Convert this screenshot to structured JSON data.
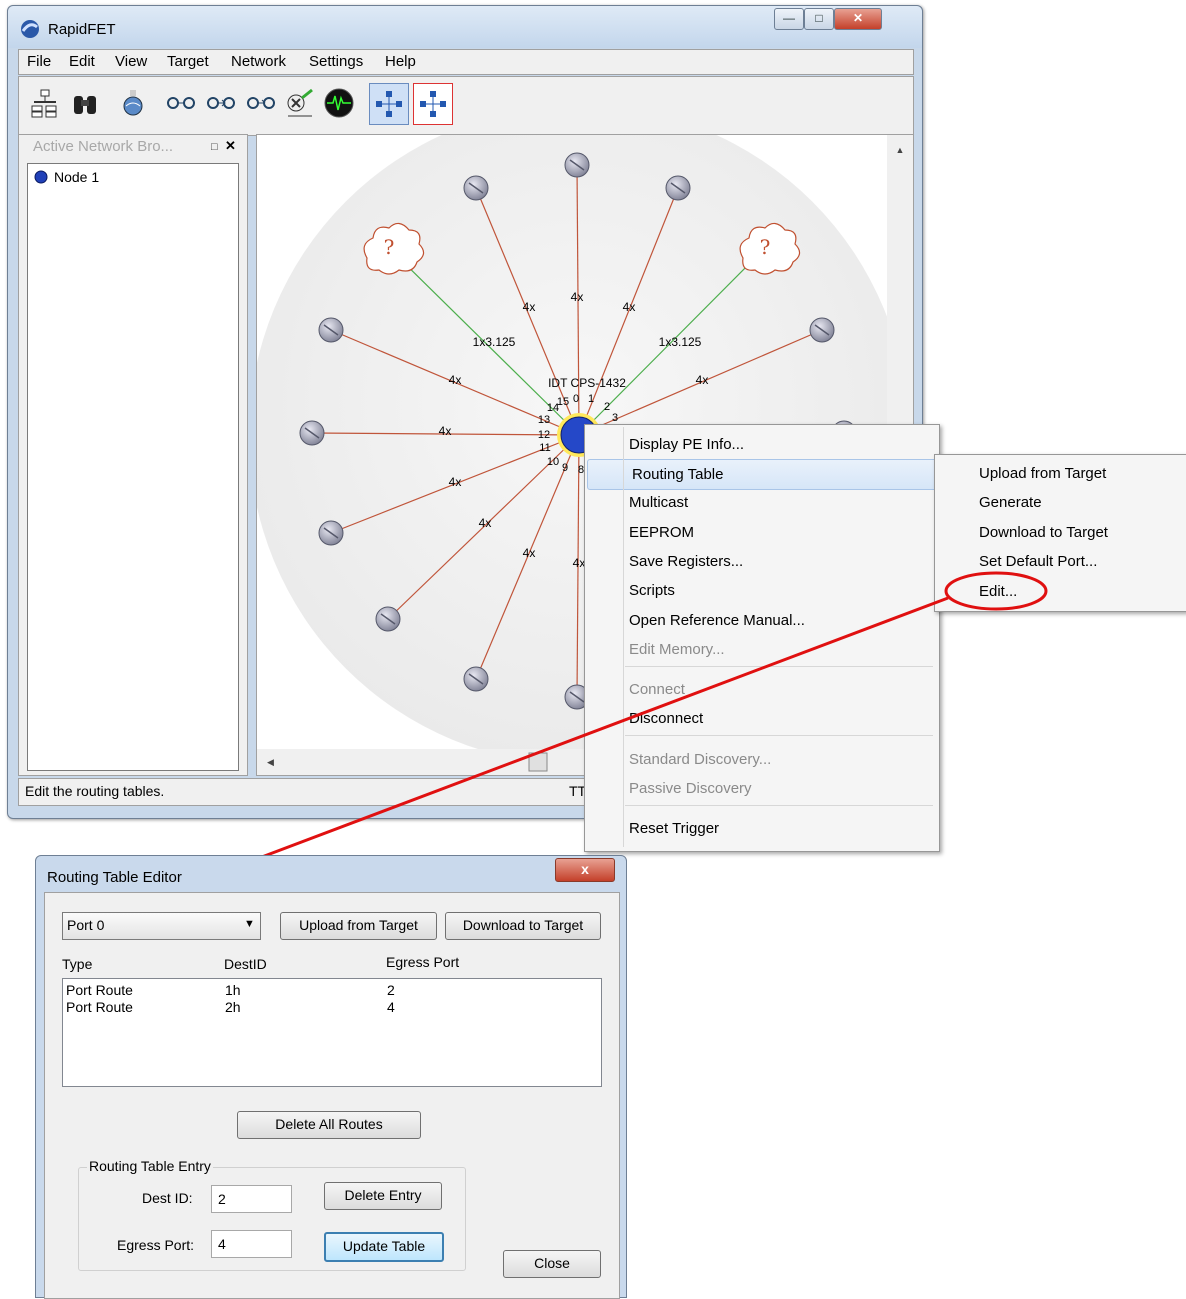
{
  "app": {
    "title": "RapidFET",
    "menus": [
      "File",
      "Edit",
      "View",
      "Target",
      "Network",
      "Settings",
      "Help"
    ],
    "browser_title": "Active Network Bro...",
    "tree_node": "Node 1",
    "status_text": "Edit the routing tables.",
    "status_right": "TT"
  },
  "topology": {
    "switch_label": "IDT CPS-1432",
    "link_label_4x": "4x",
    "link_label_1x": "1x3.125",
    "unknown_label": "?",
    "port_numbers": [
      "0",
      "1",
      "2",
      "3",
      "8",
      "9",
      "10",
      "11",
      "12",
      "13",
      "14",
      "15"
    ]
  },
  "context_menu": {
    "items": [
      {
        "label": "Display PE Info...",
        "disabled": false,
        "submenu": false
      },
      {
        "label": "Routing Table",
        "disabled": false,
        "submenu": true,
        "highlighted": true
      },
      {
        "label": "Multicast",
        "disabled": false,
        "submenu": true
      },
      {
        "label": "EEPROM",
        "disabled": false,
        "submenu": true
      },
      {
        "label": "Save Registers...",
        "disabled": false,
        "submenu": false
      },
      {
        "label": "Scripts",
        "disabled": false,
        "submenu": true
      },
      {
        "label": "Open Reference Manual...",
        "disabled": false,
        "submenu": false
      },
      {
        "label": "Edit Memory...",
        "disabled": true,
        "submenu": false
      },
      {
        "label": "Connect",
        "disabled": true,
        "submenu": false
      },
      {
        "label": "Disconnect",
        "disabled": false,
        "submenu": false
      },
      {
        "label": "Standard Discovery...",
        "disabled": true,
        "submenu": false
      },
      {
        "label": "Passive Discovery",
        "disabled": true,
        "submenu": false
      },
      {
        "label": "Reset Trigger",
        "disabled": false,
        "submenu": false
      }
    ]
  },
  "submenu": {
    "items": [
      "Upload from Target",
      "Generate",
      "Download to Target",
      "Set Default Port...",
      "Edit..."
    ]
  },
  "dialog": {
    "title": "Routing Table Editor",
    "close_x": "x",
    "port_select": "Port 0",
    "upload_button": "Upload from Target",
    "download_button": "Download to Target",
    "columns": [
      "Type",
      "DestID",
      "Egress Port"
    ],
    "rows": [
      {
        "type": "Port Route",
        "dest": "1h",
        "egress": "2"
      },
      {
        "type": "Port Route",
        "dest": "2h",
        "egress": "4"
      }
    ],
    "delete_all_button": "Delete All Routes",
    "group_title": "Routing Table Entry",
    "dest_id_label": "Dest ID:",
    "dest_id_value": "2",
    "egress_port_label": "Egress Port:",
    "egress_port_value": "4",
    "delete_entry_button": "Delete Entry",
    "update_table_button": "Update Table",
    "close_button": "Close"
  }
}
